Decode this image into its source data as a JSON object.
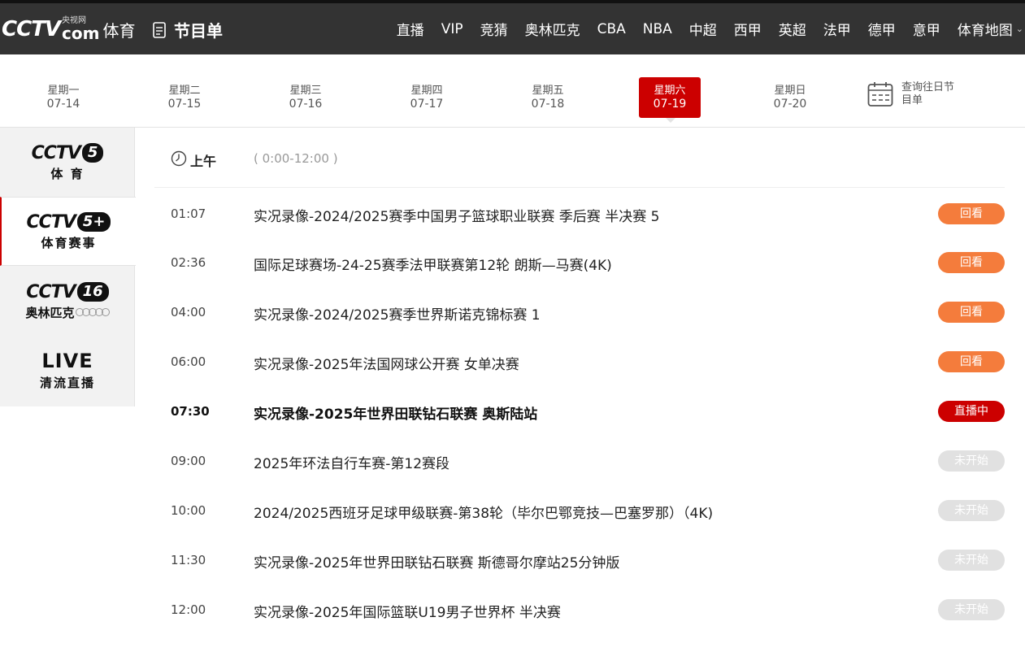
{
  "header": {
    "logo_text": "CCTV",
    "logo_small": "央视网",
    "logo_com": "com",
    "logo_sport": "体育",
    "page_title": "节目单",
    "nav": [
      "直播",
      "VIP",
      "竞猜",
      "奥林匹克",
      "CBA",
      "NBA",
      "中超",
      "西甲",
      "英超",
      "法甲",
      "德甲",
      "意甲",
      "体育地图"
    ]
  },
  "week": {
    "days": [
      {
        "weekday": "星期一",
        "date": "07-14"
      },
      {
        "weekday": "星期二",
        "date": "07-15"
      },
      {
        "weekday": "星期三",
        "date": "07-16"
      },
      {
        "weekday": "星期四",
        "date": "07-17"
      },
      {
        "weekday": "星期五",
        "date": "07-18"
      },
      {
        "weekday": "星期六",
        "date": "07-19"
      },
      {
        "weekday": "星期日",
        "date": "07-20"
      }
    ],
    "active_index": 5,
    "history_line1": "查询往日节",
    "history_line2": "目单"
  },
  "channels": [
    {
      "logo": "CCTV",
      "num": "5",
      "sub": "体 育"
    },
    {
      "logo": "CCTV",
      "num": "5+",
      "sub": "体育赛事"
    },
    {
      "logo": "CCTV",
      "num": "16",
      "sub": "奥林匹克"
    },
    {
      "logo": "LIVE",
      "num": "",
      "sub": "清流直播"
    }
  ],
  "schedule": {
    "section_label": "上午",
    "section_range": "( 0:00-12:00 )",
    "rows": [
      {
        "time": "01:07",
        "title": "实况录像-2024/2025赛季中国男子篮球职业联赛 季后赛 半决赛 5",
        "status": "回看"
      },
      {
        "time": "02:36",
        "title": "国际足球赛场-24-25赛季法甲联赛第12轮 朗斯—马赛(4K)",
        "status": "回看"
      },
      {
        "time": "04:00",
        "title": "实况录像-2024/2025赛季世界斯诺克锦标赛 1",
        "status": "回看"
      },
      {
        "time": "06:00",
        "title": "实况录像-2025年法国网球公开赛 女单决赛",
        "status": "回看"
      },
      {
        "time": "07:30",
        "title": "实况录像-2025年世界田联钻石联赛 奥斯陆站",
        "status": "直播中"
      },
      {
        "time": "09:00",
        "title": "2025年环法自行车赛-第12赛段",
        "status": "未开始"
      },
      {
        "time": "10:00",
        "title": "2024/2025西班牙足球甲级联赛-第38轮（毕尔巴鄂竞技—巴塞罗那）（4K)",
        "status": "未开始"
      },
      {
        "time": "11:30",
        "title": "实况录像-2025年世界田联钻石联赛 斯德哥尔摩站25分钟版",
        "status": "未开始"
      },
      {
        "time": "12:00",
        "title": "实况录像-2025年国际篮联U19男子世界杯 半决赛",
        "status": "未开始"
      }
    ]
  },
  "colors": {
    "header_bg": "#333333",
    "active_red": "#cc0000",
    "replay_orange": "#f47c3c",
    "pending_gray": "#e1e1e1"
  }
}
